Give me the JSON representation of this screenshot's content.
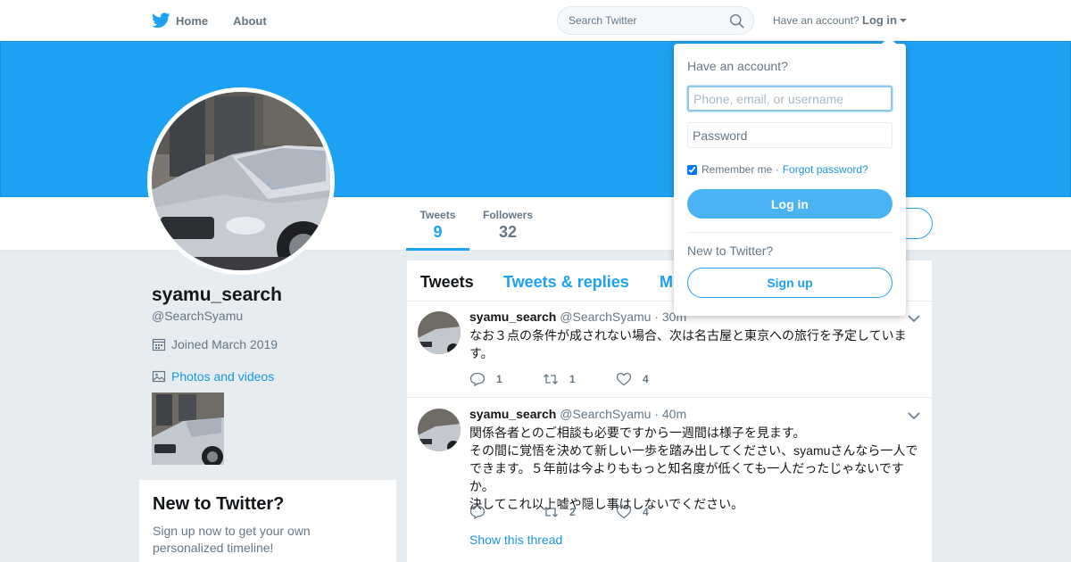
{
  "nav": {
    "home_label": "Home",
    "about_label": "About",
    "search_placeholder": "Search Twitter",
    "account_question": "Have an account?",
    "login_label": "Log in"
  },
  "profile": {
    "name": "syamu_search",
    "handle": "@SearchSyamu",
    "joined": "Joined March 2019",
    "photos_label": "Photos and videos"
  },
  "stats": [
    {
      "label": "Tweets",
      "value": "9"
    },
    {
      "label": "Followers",
      "value": "32"
    }
  ],
  "new_to_twitter": {
    "title": "New to Twitter?",
    "text": "Sign up now to get your own personalized timeline!"
  },
  "timeline": {
    "tabs": [
      "Tweets",
      "Tweets & replies",
      "M"
    ],
    "tweets": [
      {
        "name": "syamu_search",
        "handle": "@SearchSyamu",
        "time": "· 30m",
        "text": "なお３点の条件が成されない場合、次は名古屋と東京への旅行を予定しています。",
        "replies": "1",
        "retweets": "1",
        "likes": "4"
      },
      {
        "name": "syamu_search",
        "handle": "@SearchSyamu",
        "time": "· 40m",
        "text_lines": [
          "関係各者とのご相談も必要ですから一週間は様子を見ます。",
          "その間に覚悟を決めて新しい一歩を踏み出してください、syamuさんなら一人でできます。５年前は今よりももっと知名度が低くても一人だったじゃないですか。",
          "決してこれ以上嘘や隠し事はしないでください。"
        ],
        "replies": "",
        "retweets": "2",
        "likes": "4",
        "thread_link": "Show this thread"
      }
    ]
  },
  "login_dropdown": {
    "title": "Have an account?",
    "user_placeholder": "Phone, email, or username",
    "password_placeholder": "Password",
    "remember_label": "Remember me ·",
    "forgot_label": "Forgot password?",
    "login_button": "Log in",
    "new_label": "New to Twitter?",
    "signup_button": "Sign up"
  },
  "colors": {
    "brand": "#1da1f2",
    "link": "#1b95e0",
    "muted": "#657786"
  }
}
